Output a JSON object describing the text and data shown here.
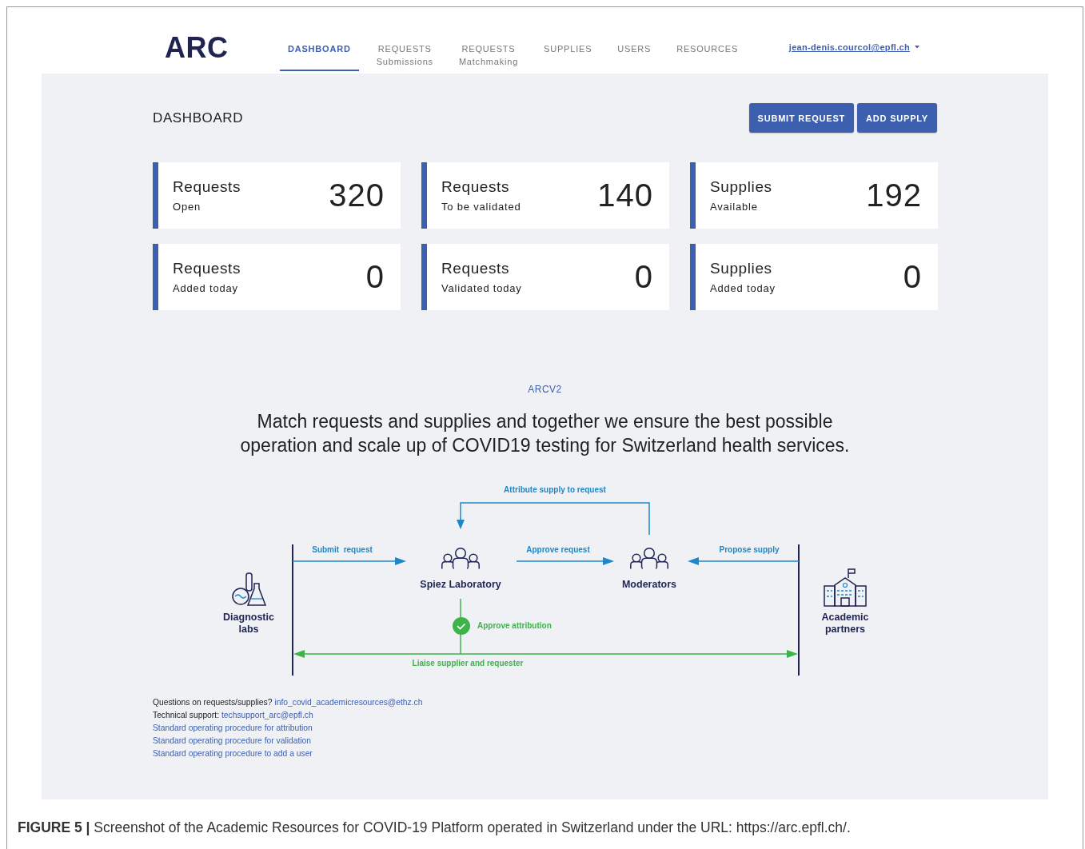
{
  "header": {
    "logo": "ARC",
    "tabs": [
      {
        "label": "DASHBOARD",
        "selected": true
      },
      {
        "label": "REQUESTS",
        "sublabel": "Submissions",
        "selected": false
      },
      {
        "label": "REQUESTS",
        "sublabel": "Matchmaking",
        "selected": false
      },
      {
        "label": "SUPPLIES",
        "selected": false
      },
      {
        "label": "USERS",
        "selected": false
      },
      {
        "label": "RESOURCES",
        "selected": false
      }
    ],
    "user_menu": "jean-denis.courcol@epfl.ch"
  },
  "page_title": "DASHBOARD",
  "buttons": [
    "SUBMIT REQUEST",
    "ADD SUPPLY"
  ],
  "stats": [
    {
      "title": "Requests",
      "subtitle": "Open",
      "value": "320"
    },
    {
      "title": "Requests",
      "subtitle": "To be validated",
      "value": "140"
    },
    {
      "title": "Supplies",
      "subtitle": "Available",
      "value": "192"
    },
    {
      "title": "Requests",
      "subtitle": "Added today",
      "value": "0"
    },
    {
      "title": "Requests",
      "subtitle": "Validated today",
      "value": "0"
    },
    {
      "title": "Supplies",
      "subtitle": "Added today",
      "value": "0"
    }
  ],
  "intro": {
    "eyebrow": "ARCV2",
    "headline": "Match requests and supplies and together we ensure the best possible operation and scale up of COVID19 testing for Switzerland health services."
  },
  "diagram": {
    "actors": [
      "Diagnostic labs",
      "Spiez Laboratory",
      "Moderators",
      "Academic partners"
    ],
    "flows": [
      "Attribute supply to request",
      "Submit  request",
      "Approve request",
      "Propose supply",
      "Approve attribution",
      "Liaise supplier and requester"
    ]
  },
  "footer": [
    {
      "label": "Questions on requests/supplies?",
      "link": "info_covid_academicresources@ethz.ch"
    },
    {
      "label": "Technical support:",
      "link": "techsupport_arc@epfl.ch"
    },
    {
      "link": "Standard operating procedure for attribution"
    },
    {
      "link": "Standard operating procedure for validation"
    },
    {
      "link": "Standard operating procedure to add a user"
    }
  ],
  "caption": "**FIGURE 5 |** Screenshot of the Academic Resources for COVID-19 Platform operated in Switzerland under the URL: https://arc.epfl.ch/."
}
